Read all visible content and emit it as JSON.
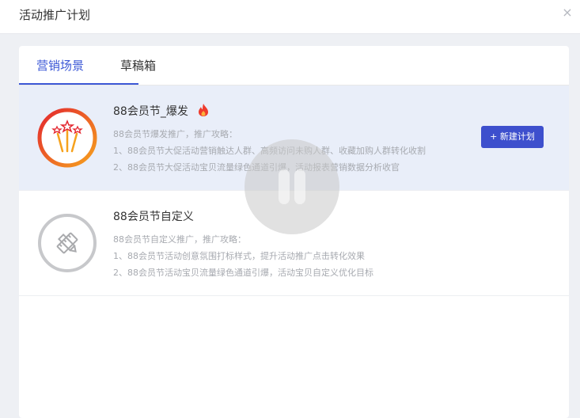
{
  "dialog": {
    "title": "活动推广计划",
    "close_icon": "×"
  },
  "tabs": [
    {
      "label": "营销场景",
      "active": true
    },
    {
      "label": "草稿箱",
      "active": false
    }
  ],
  "colors": {
    "accent": "#3b57d6",
    "button": "#3d4fcd",
    "highlight_bg": "#e9eef9"
  },
  "cards": [
    {
      "title": "88会员节_爆发",
      "icon": "fireworks-icon",
      "badge_icon": "flame-icon",
      "lines": [
        "88会员节爆发推广，推广攻略：",
        "1、88会员节大促活动营销触达人群、高频访问未购人群、收藏加购人群转化收割",
        "2、88会员节大促活动宝贝流量绿色通道引爆，活动报表营销数据分析收官"
      ],
      "button": "+ 新建计划"
    },
    {
      "title": "88会员节自定义",
      "icon": "pencil-ruler-icon",
      "lines": [
        "88会员节自定义推广，推广攻略：",
        "1、88会员节活动创意氛围打标样式，提升活动推广点击转化效果",
        "2、88会员节活动宝贝流量绿色通道引爆，活动宝贝自定义优化目标"
      ]
    }
  ]
}
